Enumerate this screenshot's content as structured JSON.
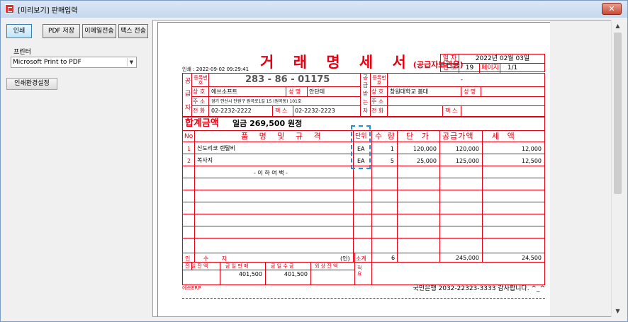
{
  "window": {
    "title": "[미리보기] 판매입력",
    "close": "✕"
  },
  "toolbar": {
    "print": "인쇄",
    "pdf_save": "PDF 저장",
    "email": "이메일전송",
    "fax": "팩스 전송"
  },
  "printer": {
    "label": "프린터",
    "selected": "Microsoft Print to PDF"
  },
  "setup_button": "인쇄환경설정",
  "doc": {
    "title": "거 래 명 세 서",
    "subtitle": "(공급자보관용)",
    "printed_at": "인쇄 : 2022-09-02 09:29:41",
    "date_label": "일 자",
    "date_value": "2022년 02월 03일",
    "no_label": "번 호",
    "no_value": "19",
    "page_label": "페이지",
    "page_value": "1/1",
    "supplier": {
      "side_label": "공급자",
      "side_chars": [
        "공",
        "급",
        "자"
      ],
      "reg_label": "등록번호",
      "reg_no": "283 - 86 - 01175",
      "name_label": "상 호",
      "name": "에쓰소프트",
      "rep_label": "성 명",
      "rep": "안단테",
      "addr_label": "주 소",
      "addr": "경기 안산시 단원구 원곡로1길 15 (원곡동) 101호",
      "tel_label": "전 화",
      "tel": "02-2232-2222",
      "fax_label": "팩 스",
      "fax": "02-2232-2223"
    },
    "receiver": {
      "side_chars": [
        "공",
        "급",
        "받",
        "는",
        "자"
      ],
      "reg_label": "등록번호",
      "reg_no": "-",
      "name_label": "상 호",
      "name": "창원대학교 봄대",
      "rep_label": "성 명",
      "addr_label": "주 소",
      "tel_label": "전 화",
      "fax_label": "팩 스"
    },
    "total_label": "합계금액",
    "total_value": "일금 269,500 원정",
    "columns": {
      "no": "No",
      "item": "품 명 및 규 격",
      "unit": "단위",
      "qty": "수 량",
      "price": "단 가",
      "supply": "공급가액",
      "tax": "세 액"
    },
    "rows": [
      {
        "no": "1",
        "item": "신도리코 렌탈비",
        "unit": "EA",
        "qty": "1",
        "price": "120,000",
        "supply": "120,000",
        "tax": "12,000"
      },
      {
        "no": "2",
        "item": "복사지",
        "unit": "EA",
        "qty": "5",
        "price": "25,000",
        "supply": "125,000",
        "tax": "12,500"
      }
    ],
    "blank_note": "- 이 하 여 백 -",
    "receipt_label": "인 수 자",
    "receipt_seal": "(인)",
    "subtotal_label": "소계",
    "subtotal_qty": "6",
    "subtotal_supply": "245,000",
    "subtotal_tax": "24,500",
    "balance_labels": {
      "prev": "전 일 잔 액",
      "sales": "금 일 판 매",
      "collect": "금 일 수 금",
      "outstanding": "외 상 잔 액"
    },
    "balance_values": {
      "sales": "401,500",
      "collect": "401,500"
    },
    "memo_label": "적요",
    "footer_left": "에쓰ERP",
    "footer_right": "국민은행 2032-22323-3333 감사합니다. ^_^"
  }
}
